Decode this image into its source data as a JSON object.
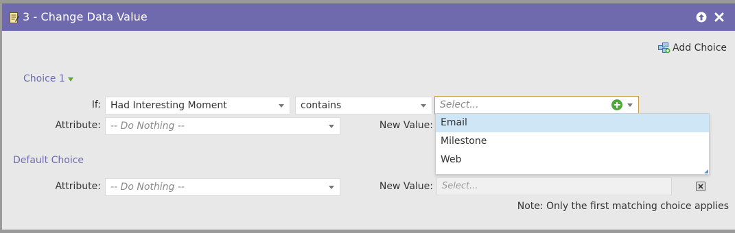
{
  "dialog": {
    "title": "3 - Change Data Value",
    "title_icon": "edit-document-icon",
    "collapse_icon": "arrow-up-circle-icon",
    "close_icon": "close-x-icon"
  },
  "toolbar": {
    "add_choice_label": "Add Choice",
    "add_choice_icon": "add-choice-icon"
  },
  "choice1": {
    "heading": "Choice 1",
    "if_label": "If:",
    "field_value": "Had Interesting Moment",
    "operator_value": "contains",
    "value_placeholder": "Select...",
    "attribute_label": "Attribute:",
    "attribute_placeholder": "-- Do Nothing --",
    "new_value_label": "New Value:"
  },
  "dropdown": {
    "options": [
      "Email",
      "Milestone",
      "Web"
    ],
    "highlighted": "Email"
  },
  "default_choice": {
    "heading": "Default Choice",
    "attribute_label": "Attribute:",
    "attribute_placeholder": "-- Do Nothing --",
    "new_value_label": "New Value:",
    "new_value_placeholder": "Select..."
  },
  "note": "Note: Only the first matching choice applies",
  "colors": {
    "titlebar": "#6f6aad",
    "heading": "#6f6aad",
    "highlight": "#cfe6f7",
    "add_green": "#4ea83b"
  }
}
